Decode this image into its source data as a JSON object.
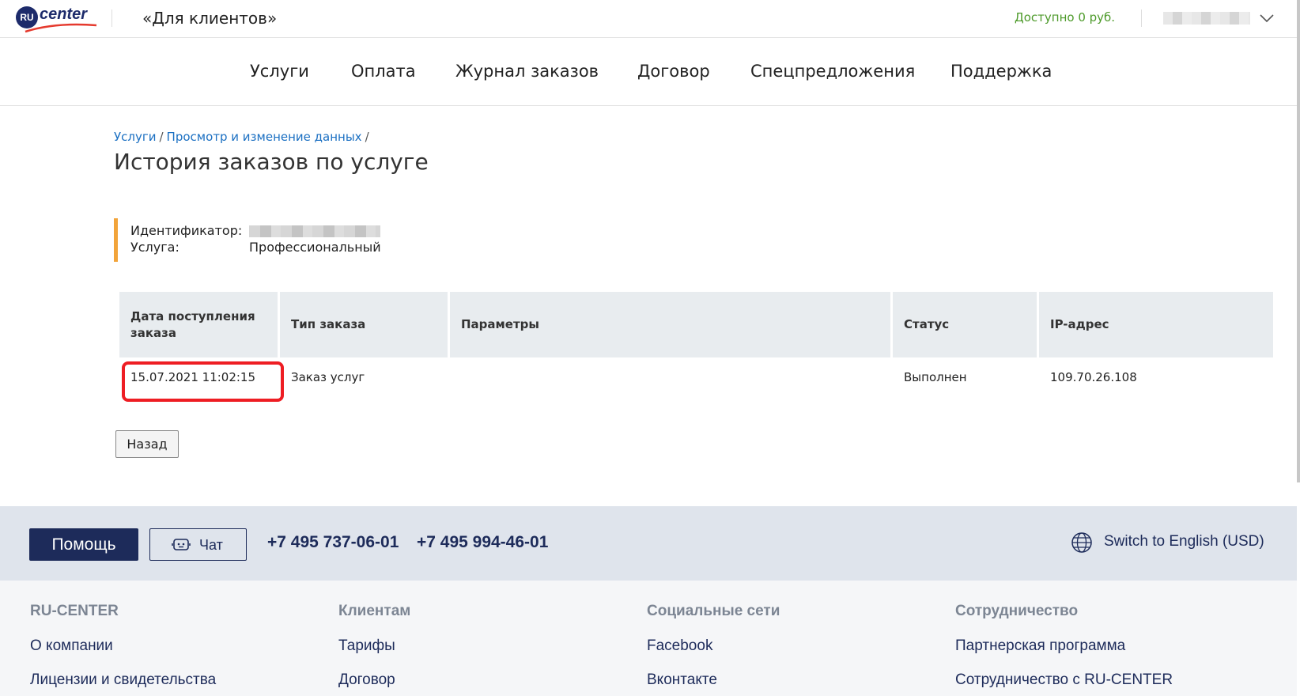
{
  "header": {
    "logo_ru": "RU",
    "logo_word": "center",
    "portal_title": "«Для клиентов»",
    "balance": "Доступно 0 руб."
  },
  "nav": {
    "items": [
      {
        "label": "Услуги"
      },
      {
        "label": "Оплата"
      },
      {
        "label": "Журнал заказов"
      },
      {
        "label": "Договор"
      },
      {
        "label": "Спецпредложения"
      },
      {
        "label": "Поддержка"
      }
    ]
  },
  "breadcrumb": {
    "items": [
      {
        "label": "Услуги"
      },
      {
        "label": "Просмотр и изменение данных"
      }
    ],
    "separator": "/"
  },
  "page": {
    "title": "История заказов по услуге"
  },
  "info": {
    "id_label": "Идентификатор:",
    "service_label": "Услуга:",
    "service_value": "Профессиональный"
  },
  "table": {
    "columns": [
      {
        "label": "Дата поступления заказа"
      },
      {
        "label": "Тип заказа"
      },
      {
        "label": "Параметры"
      },
      {
        "label": "Статус"
      },
      {
        "label": "IP-адрес"
      }
    ],
    "rows": [
      {
        "date": "15.07.2021 11:02:15",
        "type": "Заказ услуг",
        "params": "",
        "status": "Выполнен",
        "ip": "109.70.26.108"
      }
    ]
  },
  "buttons": {
    "back": "Назад"
  },
  "helpbar": {
    "help": "Помощь",
    "chat": "Чат",
    "phone1": "+7 495 737-06-01",
    "phone2": "+7 495 994-46-01",
    "lang": "Switch to English (USD)"
  },
  "footer": {
    "columns": [
      {
        "title": "RU-CENTER",
        "links": [
          {
            "label": "О компании"
          },
          {
            "label": "Лицензии и свидетельства"
          }
        ]
      },
      {
        "title": "Клиентам",
        "links": [
          {
            "label": "Тарифы"
          },
          {
            "label": "Договор"
          }
        ]
      },
      {
        "title": "Социальные сети",
        "links": [
          {
            "label": "Facebook"
          },
          {
            "label": "Вконтакте"
          }
        ]
      },
      {
        "title": "Сотрудничество",
        "links": [
          {
            "label": "Партнерская программа"
          },
          {
            "label": "Сотрудничество с RU-CENTER"
          }
        ]
      }
    ]
  },
  "colors": {
    "brand": "#1d2b5a",
    "link": "#1a6fc2",
    "balance_green": "#4d9a2a",
    "accent_orange": "#f2a43a",
    "highlight_red": "#ee1d23"
  },
  "icons": {
    "chevron": "chevron-down-icon",
    "chat": "chat-bot-icon",
    "globe": "globe-icon"
  }
}
